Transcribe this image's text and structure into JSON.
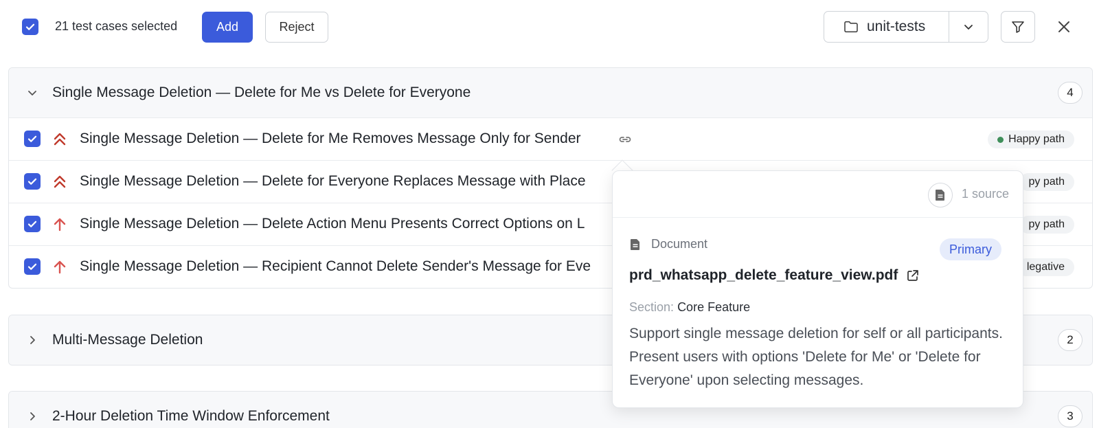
{
  "toolbar": {
    "selected_text": "21 test cases selected",
    "add_label": "Add",
    "reject_label": "Reject",
    "folder_value": "unit-tests",
    "accent_color": "#3b5bdb"
  },
  "groups": [
    {
      "title": "Single Message Deletion — Delete for Me vs Delete for Everyone",
      "count": "4",
      "expanded": true,
      "rows": [
        {
          "title": "Single Message Deletion — Delete for Me Removes Message Only for Sender",
          "priority": "highest",
          "tag": "Happy path"
        },
        {
          "title": "Single Message Deletion — Delete for Everyone Replaces Message with Place",
          "priority": "highest",
          "tag": "py path"
        },
        {
          "title": "Single Message Deletion — Delete Action Menu Presents Correct Options on L",
          "priority": "high",
          "tag": "py path"
        },
        {
          "title": "Single Message Deletion — Recipient Cannot Delete Sender's Message for Eve",
          "priority": "high",
          "tag": "legative"
        }
      ]
    },
    {
      "title": "Multi-Message Deletion",
      "count": "2",
      "expanded": false
    },
    {
      "title": "2-Hour Deletion Time Window Enforcement",
      "count": "3",
      "expanded": false
    }
  ],
  "popover": {
    "source_count": "1 source",
    "doc_type": "Document",
    "badge": "Primary",
    "file_name": "prd_whatsapp_delete_feature_view.pdf",
    "section_label": "Section:",
    "section_value": "Core Feature",
    "description": "Support single message deletion for self or all participants. Present users with options 'Delete for Me' or 'Delete for Everyone' upon selecting messages."
  }
}
